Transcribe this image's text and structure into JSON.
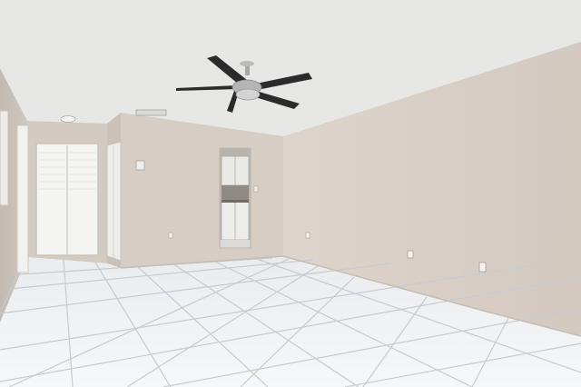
{
  "scene": {
    "colors": {
      "ceiling": "#ebebea",
      "wall_right": "#dcd3cb",
      "wall_back": "#d6cdc4",
      "wall_left": "#cdc4bb",
      "floor": "#f1f3f5",
      "grout": "#c9ccd0",
      "door_white": "#f4f4f2",
      "fan_blade": "#2a2a2a",
      "fan_metal": "#b9b9b9"
    }
  }
}
